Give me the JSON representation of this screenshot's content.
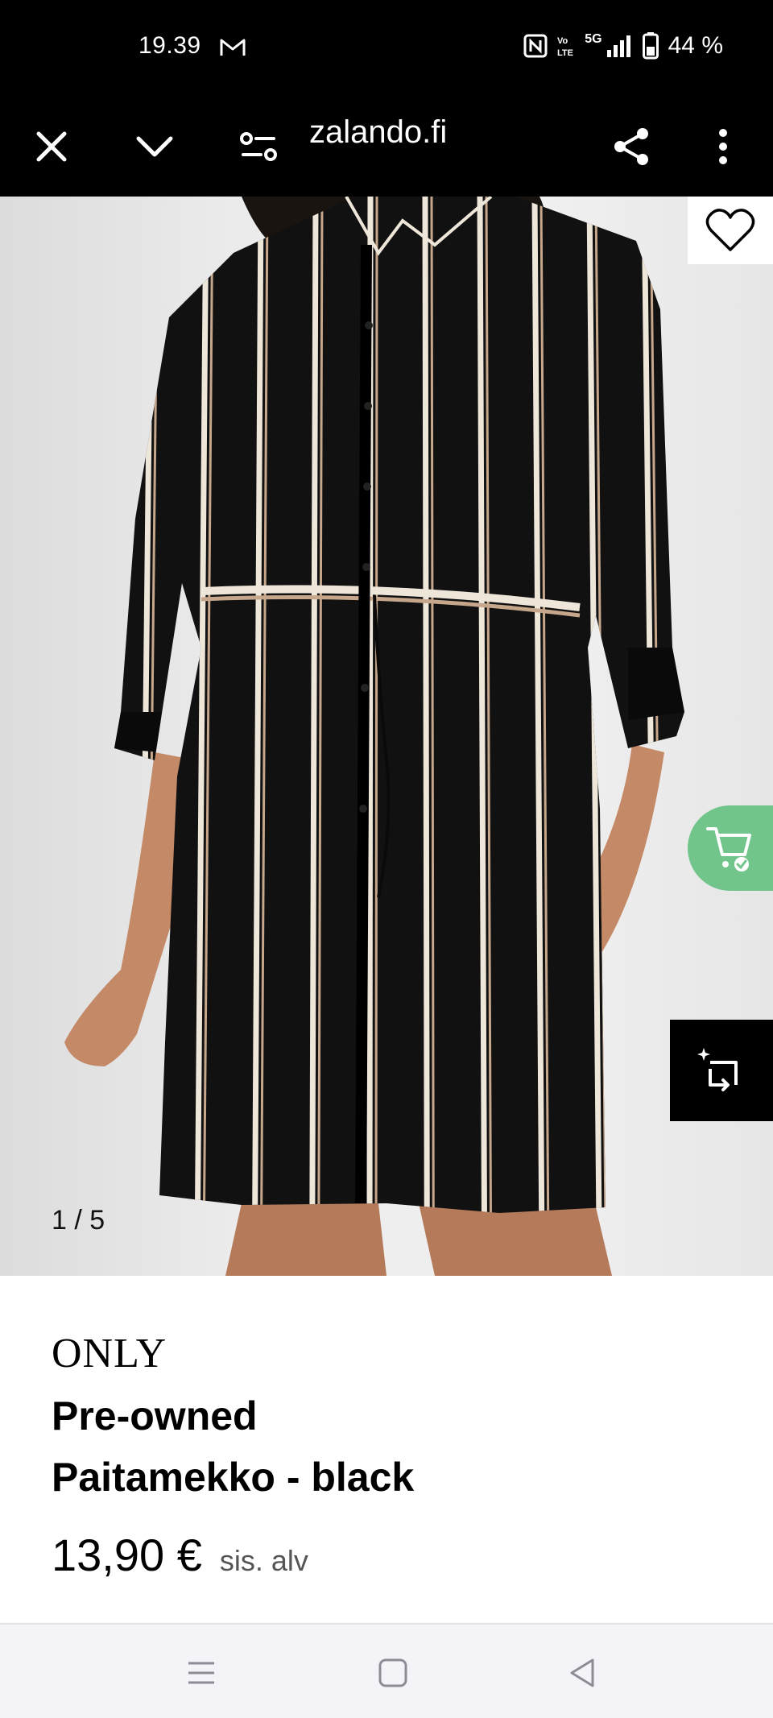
{
  "status": {
    "time": "19.39",
    "network": "5G",
    "battery": "44 %",
    "icons": [
      "gmail-icon",
      "nfc-icon",
      "volte-icon",
      "signal-icon",
      "battery-icon"
    ]
  },
  "browser": {
    "url": "zalando.fi",
    "icons": [
      "close-icon",
      "chevron-down-icon",
      "site-settings-icon",
      "share-icon",
      "more-vert-icon"
    ]
  },
  "gallery": {
    "counter": "1 / 5",
    "image": "striped-shirt-dress-photo",
    "buttons": [
      "heart-icon",
      "add-to-cart-icon",
      "compare-icon"
    ]
  },
  "product": {
    "brand": "ONLY",
    "title_line1": "Pre-owned",
    "title_line2": "Paitamekko - black",
    "price": "13,90 €",
    "tax_note": "sis. alv"
  },
  "navigation": {
    "icons": [
      "menu-icon",
      "home-icon",
      "back-icon"
    ]
  },
  "colors": {
    "bar_background": "#000000",
    "cart_accent": "#71c58a",
    "page_background": "#ffffff",
    "dress_black": "#111111",
    "stripe_cream": "#efe6da",
    "stripe_tan": "#c6a78c"
  }
}
